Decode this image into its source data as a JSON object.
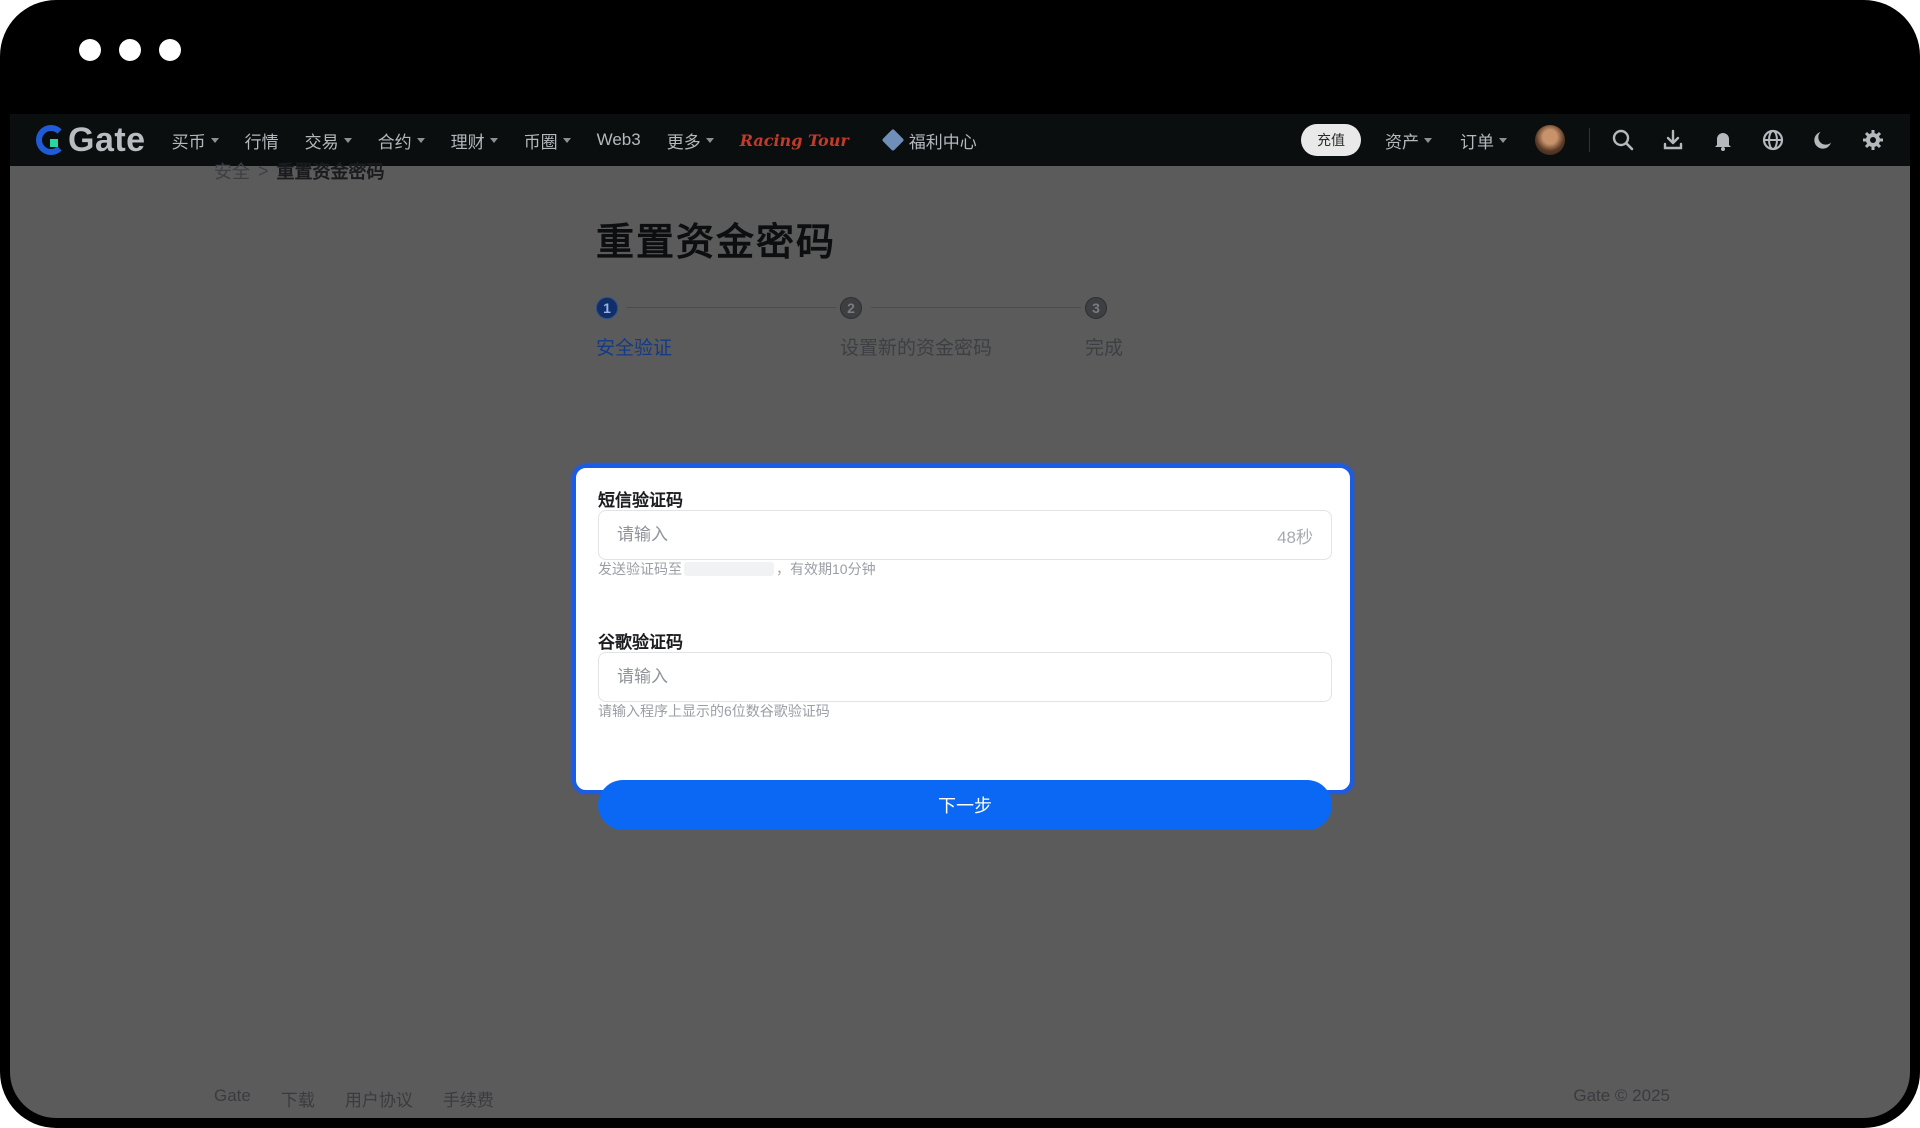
{
  "nav": {
    "logo_text": "Gate",
    "items": [
      {
        "label": "买币",
        "dropdown": true
      },
      {
        "label": "行情",
        "dropdown": false
      },
      {
        "label": "交易",
        "dropdown": true
      },
      {
        "label": "合约",
        "dropdown": true
      },
      {
        "label": "理财",
        "dropdown": true
      },
      {
        "label": "币圈",
        "dropdown": true
      },
      {
        "label": "Web3",
        "dropdown": false
      },
      {
        "label": "更多",
        "dropdown": true
      }
    ],
    "promo_label": "Racing Tour",
    "welfare_label": "福利中心",
    "deposit_label": "充值",
    "assets_label": "资产",
    "orders_label": "订单",
    "icons": [
      "search-icon",
      "download-icon",
      "bell-icon",
      "globe-icon",
      "moon-icon",
      "gear-icon"
    ]
  },
  "breadcrumb": {
    "parent": "安全",
    "separator": ">",
    "current": "重置资金密码"
  },
  "page_title": "重置资金密码",
  "steps": [
    {
      "number": "1",
      "label": "安全验证",
      "active": true
    },
    {
      "number": "2",
      "label": "设置新的资金密码",
      "active": false
    },
    {
      "number": "3",
      "label": "完成",
      "active": false
    }
  ],
  "form": {
    "sms": {
      "label": "短信验证码",
      "placeholder": "请输入",
      "countdown": "48秒",
      "hint_prefix": "发送验证码至",
      "hint_suffix": "，有效期10分钟"
    },
    "google": {
      "label": "谷歌验证码",
      "placeholder": "请输入",
      "hint": "请输入程序上显示的6位数谷歌验证码"
    },
    "next_label": "下一步"
  },
  "footer": {
    "links": [
      "Gate",
      "下载",
      "用户协议",
      "手续费"
    ],
    "copyright": "Gate © 2025"
  },
  "colors": {
    "primary": "#0a68f5",
    "card_border": "#1a5ce6",
    "overlay_bg": "#5b5b5b",
    "nav_bg": "#0b0e0f"
  }
}
